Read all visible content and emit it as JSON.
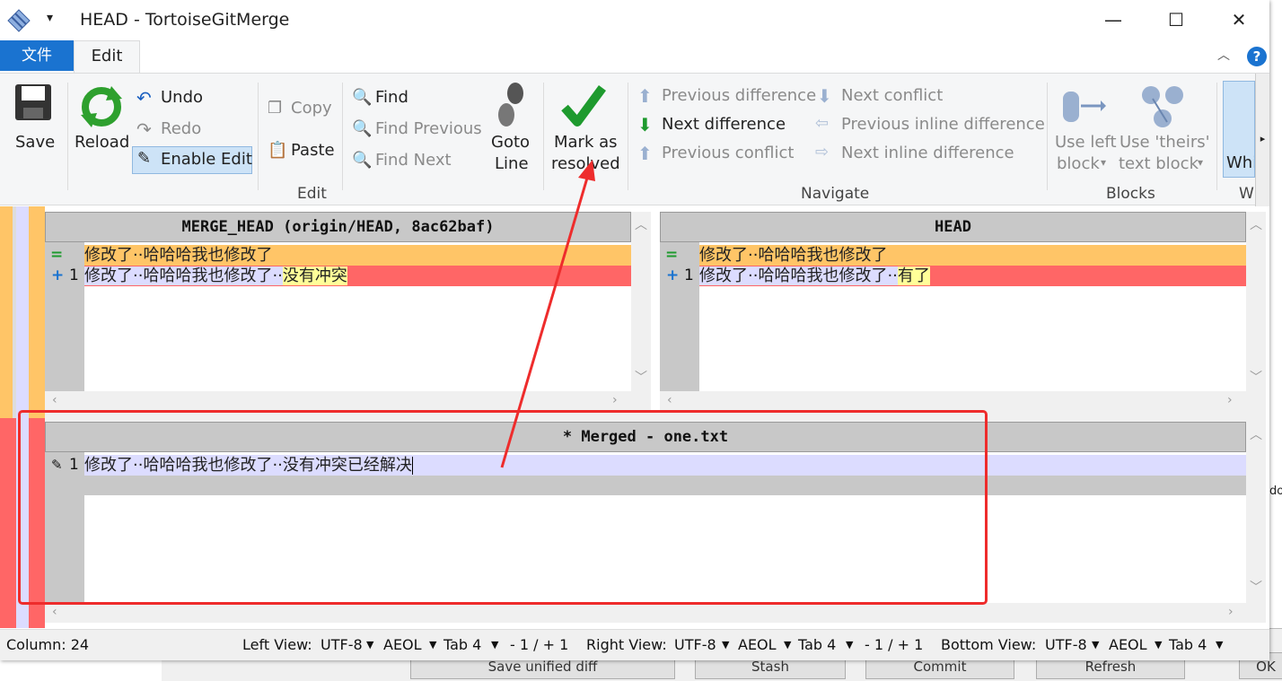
{
  "window": {
    "title": "HEAD - TortoiseGitMerge"
  },
  "tabs": {
    "file": "文件",
    "edit": "Edit",
    "help": "?"
  },
  "ribbon": {
    "save": "Save",
    "reload": "Reload",
    "undo": "Undo",
    "redo": "Redo",
    "enable_edit": "Enable Edit",
    "copy": "Copy",
    "paste": "Paste",
    "find": "Find",
    "find_previous": "Find Previous",
    "find_next": "Find Next",
    "goto_line_1": "Goto",
    "goto_line_2": "Line",
    "mark_resolved_1": "Mark as",
    "mark_resolved_2": "resolved",
    "group_edit": "Edit",
    "prev_diff": "Previous difference",
    "next_diff": "Next difference",
    "prev_conflict": "Previous conflict",
    "next_conflict": "Next conflict",
    "prev_inline": "Previous inline difference",
    "next_inline": "Next inline difference",
    "group_navigate": "Navigate",
    "use_left_1": "Use left",
    "use_left_2": "block",
    "use_theirs_1": "Use 'theirs'",
    "use_theirs_2": "text block",
    "group_blocks": "Blocks",
    "partial_1": "Whi",
    "partial_2": "W"
  },
  "panes": {
    "theirs": {
      "header": "MERGE_HEAD (origin/HEAD, 8ac62baf)",
      "line0_marker": "=",
      "line0_text": "修改了··哈哈哈我也修改了",
      "line1_marker": "+",
      "line1_num": "1",
      "line1_text_a": "修改了··哈哈哈我也修改了··",
      "line1_text_b": "没有冲突"
    },
    "mine": {
      "header": "HEAD",
      "line0_marker": "=",
      "line0_text": "修改了··哈哈哈我也修改了",
      "line1_marker": "+",
      "line1_num": "1",
      "line1_text_a": "修改了··哈哈哈我也修改了··",
      "line1_text_b": "有了"
    },
    "merged": {
      "header": "* Merged - one.txt",
      "line1_num": "1",
      "line1_text": "修改了··哈哈哈我也修改了··没有冲突已经解决"
    }
  },
  "status": {
    "column": "Column: 24",
    "left_view": "Left View:",
    "right_view": "Right View:",
    "bottom_view": "Bottom View:",
    "encoding": "UTF-8",
    "eol": "AEOL",
    "tab": "Tab 4",
    "lines": "- 1 / + 1"
  },
  "background_dialog": {
    "btn1": "Save unified diff",
    "btn2": "Stash",
    "btn3": "Commit",
    "btn4": "Refresh",
    "btn5": "OK",
    "side": "do"
  },
  "colors": {
    "accent": "#1a73d0",
    "conflict_orange": "#ffc567",
    "removed_red": "#ff6666",
    "added_lavender": "#dcdcff",
    "inline_yellow": "#ffff99",
    "annotation_red": "#ee2c2c"
  }
}
